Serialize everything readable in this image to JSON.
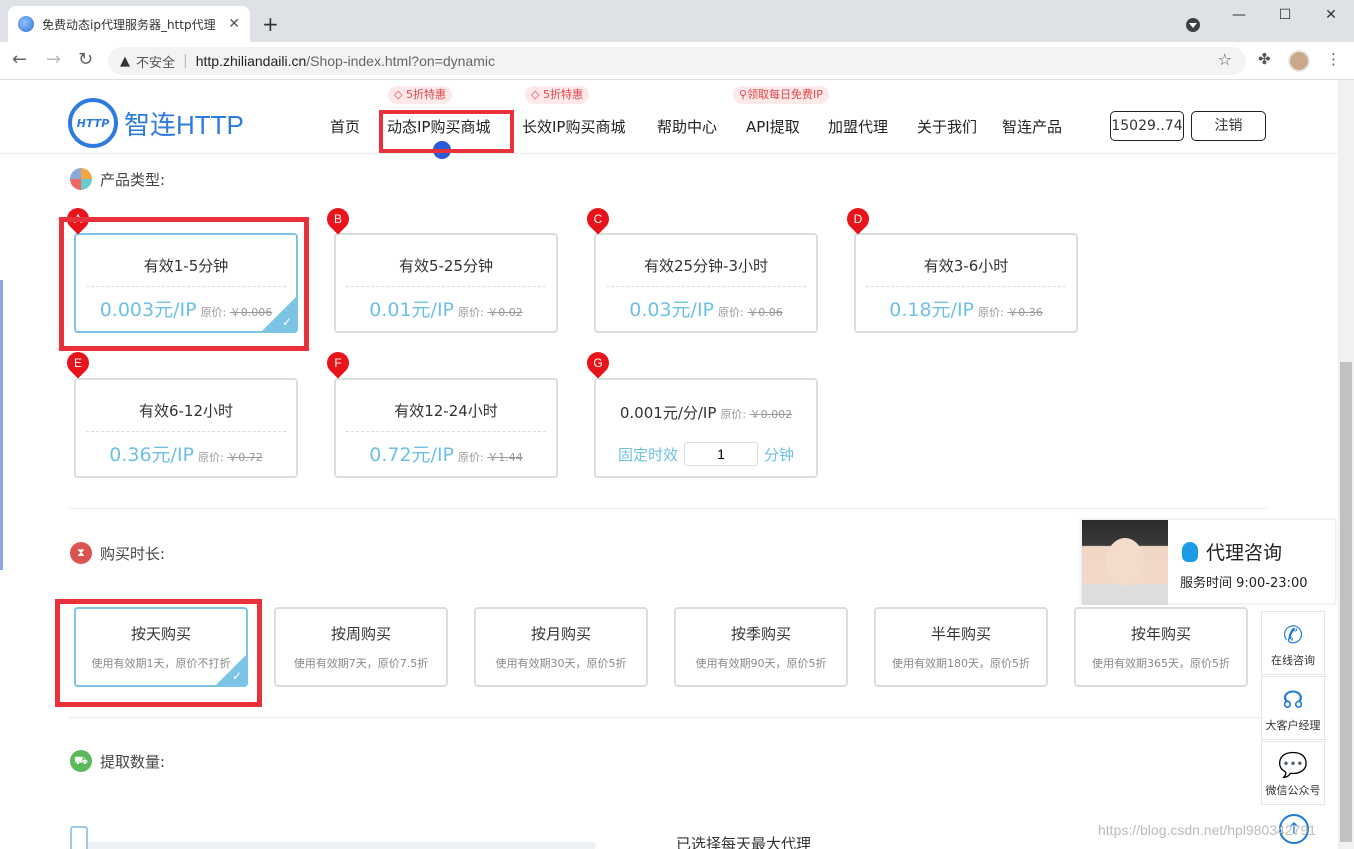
{
  "browser": {
    "tab_title": "免费动态ip代理服务器_http代理",
    "new_tab": "+",
    "insecure_label": "不安全",
    "url_host": "http.zhiliandaili.cn",
    "url_path": "/Shop-index.html?on=dynamic"
  },
  "header": {
    "logo_text": "智连HTTP",
    "logo_badge": "HTTP",
    "nav": [
      "首页",
      "动态IP购买商城",
      "长效IP购买商城",
      "帮助中心",
      "API提取",
      "加盟代理",
      "关于我们",
      "智连产品"
    ],
    "promo1": "5折特惠",
    "promo2": "5折特惠",
    "promo3": "领取每日免费IP",
    "account": "15029..74",
    "logout": "注销"
  },
  "product_section": {
    "title": "产品类型:",
    "cards": [
      {
        "pin": "A",
        "name": "有效1-5分钟",
        "price": "0.003元/IP",
        "orig_label": "原价:",
        "orig": "￥0.006"
      },
      {
        "pin": "B",
        "name": "有效5-25分钟",
        "price": "0.01元/IP",
        "orig_label": "原价:",
        "orig": "￥0.02"
      },
      {
        "pin": "C",
        "name": "有效25分钟-3小时",
        "price": "0.03元/IP",
        "orig_label": "原价:",
        "orig": "￥0.06"
      },
      {
        "pin": "D",
        "name": "有效3-6小时",
        "price": "0.18元/IP",
        "orig_label": "原价:",
        "orig": "￥0.36"
      },
      {
        "pin": "E",
        "name": "有效6-12小时",
        "price": "0.36元/IP",
        "orig_label": "原价:",
        "orig": "￥0.72"
      },
      {
        "pin": "F",
        "name": "有效12-24小时",
        "price": "0.72元/IP",
        "orig_label": "原价:",
        "orig": "￥1.44"
      }
    ],
    "custom": {
      "pin": "G",
      "price": "0.001元/分/IP",
      "orig_label": "原价:",
      "orig": "￥0.002",
      "fixed_label": "固定时效",
      "value": "1",
      "unit": "分钟"
    }
  },
  "duration_section": {
    "title": "购买时长:",
    "cards": [
      {
        "name": "按天购买",
        "desc": "使用有效期1天，原价不打折"
      },
      {
        "name": "按周购买",
        "desc": "使用有效期7天，原价7.5折"
      },
      {
        "name": "按月购买",
        "desc": "使用有效期30天，原价5折"
      },
      {
        "name": "按季购买",
        "desc": "使用有效期90天，原价5折"
      },
      {
        "name": "半年购买",
        "desc": "使用有效期180天，原价5折"
      },
      {
        "name": "按年购买",
        "desc": "使用有效期365天，原价5折"
      }
    ]
  },
  "extract_section": {
    "title": "提取数量:",
    "right_text": "已选择每天最大代理"
  },
  "consult": {
    "title": "代理咨询",
    "hours": "服务时间 9:00-23:00"
  },
  "side": {
    "online": "在线咨询",
    "manager": "大客户经理",
    "wechat": "微信公众号"
  },
  "watermark": "https://blog.csdn.net/hpl980342791",
  "colors": {
    "accent": "#6ec1e4",
    "highlight": "#e8313a",
    "brand": "#2e7be0"
  }
}
